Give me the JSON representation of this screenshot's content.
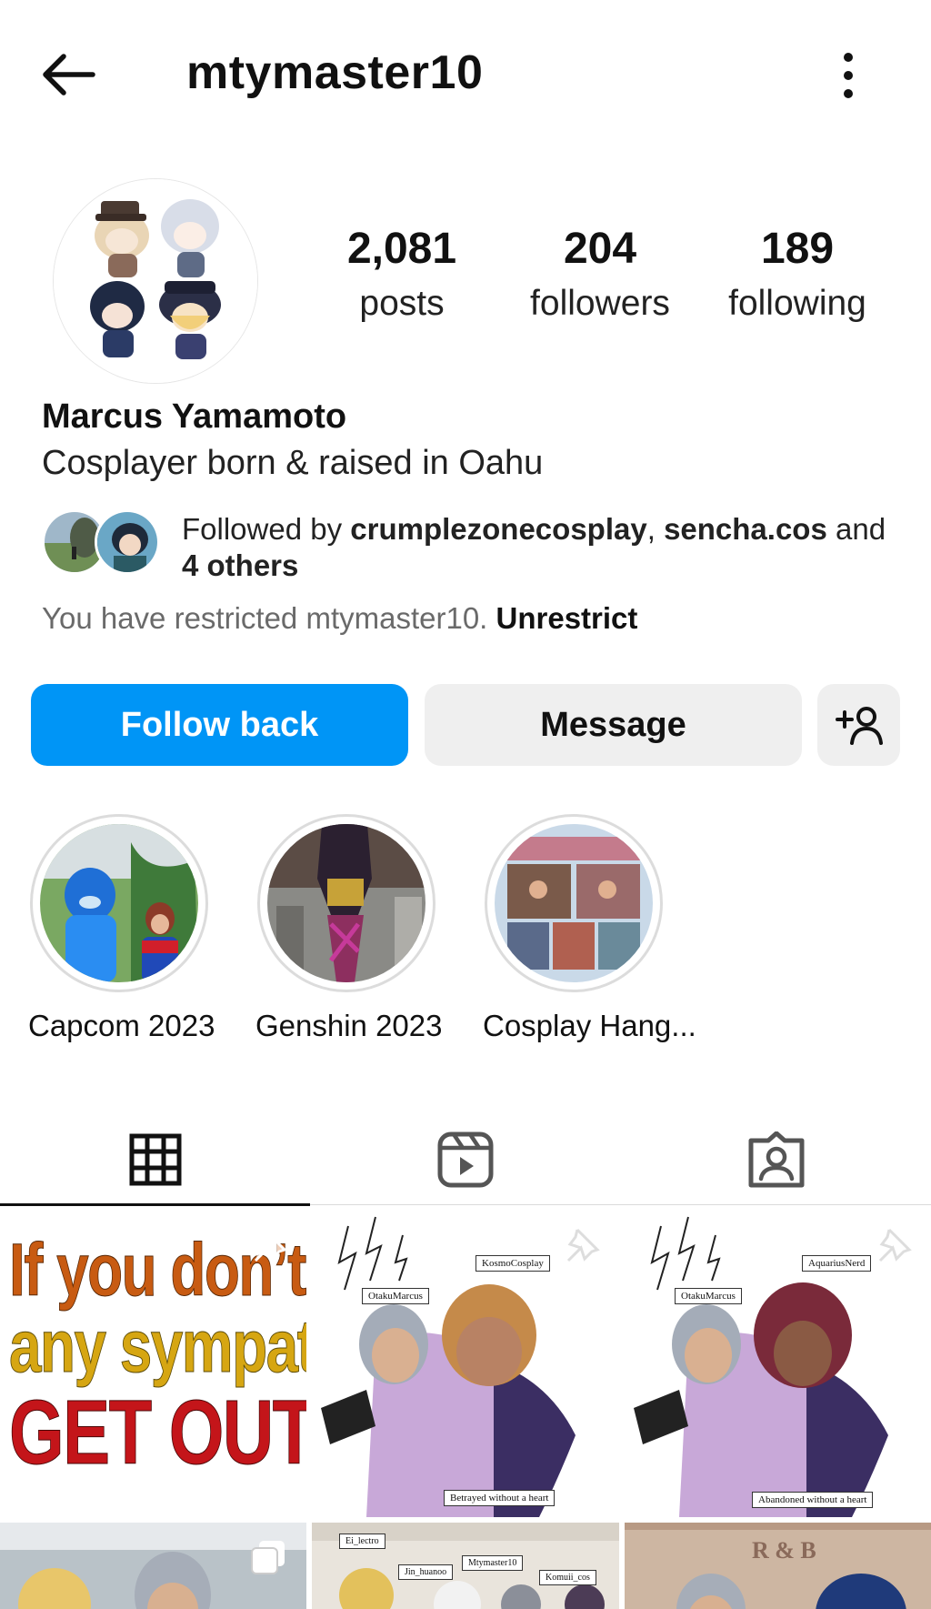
{
  "header": {
    "username": "mtymaster10"
  },
  "stats": [
    {
      "value": "2,081",
      "label": "posts"
    },
    {
      "value": "204",
      "label": "followers"
    },
    {
      "value": "189",
      "label": "following"
    }
  ],
  "profile": {
    "full_name": "Marcus Yamamoto",
    "bio": "Cosplayer born & raised in Oahu",
    "followed_by_prefix": "Followed by ",
    "followed_by_user1": "crumplezonecosplay",
    "followed_by_sep": ", ",
    "followed_by_user2": "sencha.cos",
    "followed_by_and": " and",
    "followed_by_others": "4 others",
    "restricted_text": "You have restricted mtymaster10. ",
    "unrestrict_label": "Unrestrict"
  },
  "actions": {
    "follow_back": "Follow back",
    "message": "Message"
  },
  "highlights": [
    {
      "label": "Capcom 2023"
    },
    {
      "label": "Genshin 2023"
    },
    {
      "label": "Cosplay Hang..."
    }
  ],
  "grid": {
    "post1_line1": "If you don’t have",
    "post1_line2": "any sympathy",
    "post1_line3": "GET OUT!!!",
    "post2_tag_top": "KosmoCosplay",
    "post2_tag_left": "OtakuMarcus",
    "post2_tag_bottom": "Betrayed without a heart",
    "post3_tag_top": "AquariusNerd",
    "post3_tag_left": "OtakuMarcus",
    "post3_tag_bottom": "Abandoned without a heart",
    "post5_tag1": "Ei_lectro",
    "post5_tag2": "Jin_huanoo",
    "post5_tag3": "Mtymaster10",
    "post5_tag4": "Komuii_cos",
    "post6_sign": "R & B"
  },
  "colors": {
    "primary_blue": "#0095f6",
    "secondary_button": "#efefef",
    "muted_text": "#6a6a6a"
  },
  "icons": {
    "back": "arrow-left-icon",
    "more": "vertical-dots-icon",
    "add_user": "add-user-icon",
    "grid_tab": "grid-icon",
    "reels_tab": "reels-icon",
    "tagged_tab": "tagged-user-icon",
    "pin": "pin-icon"
  }
}
